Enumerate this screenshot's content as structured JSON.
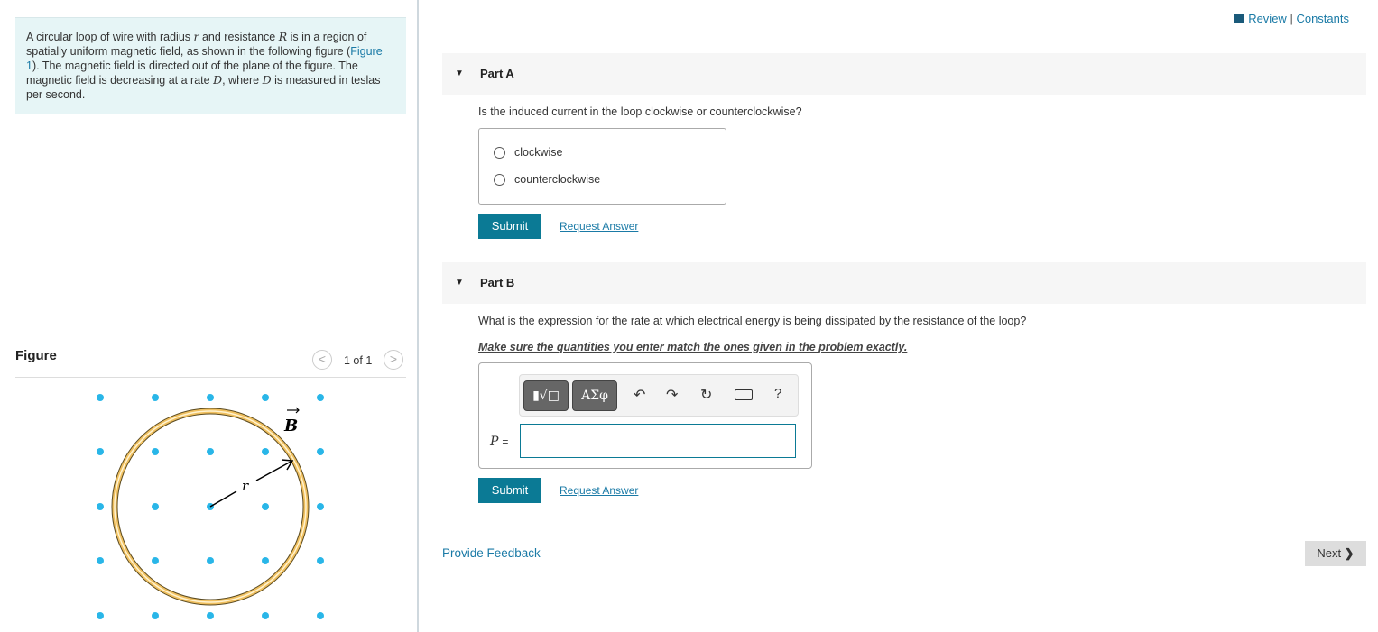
{
  "header": {
    "review_label": "Review",
    "separator": "|",
    "constants_label": "Constants"
  },
  "intro": {
    "p1": "A circular loop of wire with radius ",
    "v_r": "r",
    "p2": " and resistance ",
    "v_R": "R",
    "p3": " is in a region of spatially uniform magnetic field, as shown in the following figure (",
    "figure_link": "Figure 1",
    "p4": "). The magnetic field is directed out of the plane of the figure. The magnetic field is decreasing at a rate ",
    "v_D1": "D",
    "p5": ", where ",
    "v_D2": "D",
    "p6": " is measured in teslas per second."
  },
  "figure": {
    "title": "Figure",
    "pager": "1 of 1",
    "label_B": "B",
    "label_r": "r",
    "dot_color": "#29b6e8",
    "loop_color": "#f0c060"
  },
  "partA": {
    "title": "Part A",
    "question": "Is the induced current in the loop clockwise or counterclockwise?",
    "options": [
      "clockwise",
      "counterclockwise"
    ],
    "submit": "Submit",
    "request": "Request Answer"
  },
  "partB": {
    "title": "Part B",
    "question": "What is the expression for the rate at which electrical energy is being dissipated by the resistance of the loop?",
    "note": "Make sure the quantities you enter match the ones given in the problem exactly.",
    "greek_button": "ΑΣφ",
    "help": "?",
    "var_label": "P",
    "equals": "=",
    "input_value": "",
    "submit": "Submit",
    "request": "Request Answer"
  },
  "footer": {
    "feedback": "Provide Feedback",
    "next": "Next"
  },
  "colors": {
    "accent": "#0b7a95",
    "link": "#1a7aa6"
  }
}
